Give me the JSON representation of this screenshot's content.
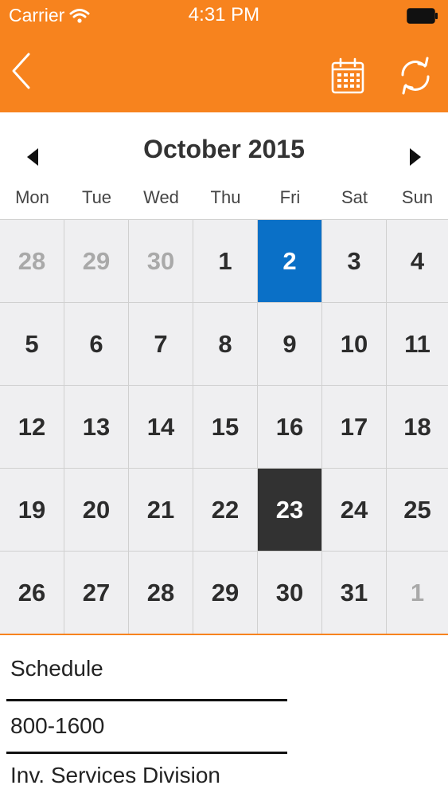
{
  "status_bar": {
    "carrier": "Carrier",
    "time": "4:31 PM"
  },
  "nav": {
    "icons": [
      "back-chevron-icon",
      "calendar-icon",
      "refresh-icon"
    ]
  },
  "calendar": {
    "month_label": "October 2015",
    "weekdays": [
      "Mon",
      "Tue",
      "Wed",
      "Thu",
      "Fri",
      "Sat",
      "Sun"
    ],
    "weeks": [
      [
        "28",
        "29",
        "30",
        "1",
        "2",
        "3",
        "4"
      ],
      [
        "5",
        "6",
        "7",
        "8",
        "9",
        "10",
        "11"
      ],
      [
        "12",
        "13",
        "14",
        "15",
        "16",
        "17",
        "18"
      ],
      [
        "19",
        "20",
        "21",
        "22",
        "23",
        "24",
        "25"
      ],
      [
        "26",
        "27",
        "28",
        "29",
        "30",
        "31",
        "1"
      ]
    ],
    "today_day": "2",
    "selected_day": "23"
  },
  "details": {
    "label": "Schedule",
    "hours": "800-1600",
    "division": "Inv. Services Division"
  },
  "colors": {
    "header": "#f7831e",
    "today": "#0a70c7",
    "selected": "#323232"
  }
}
